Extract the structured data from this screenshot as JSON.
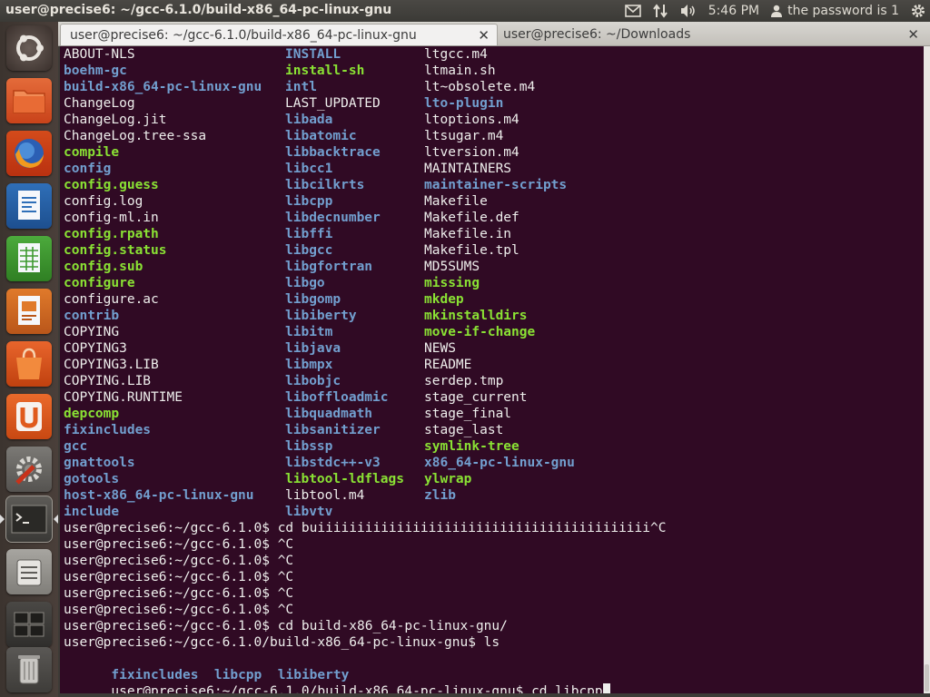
{
  "top_panel": {
    "window_title": "user@precise6: ~/gcc-6.1.0/build-x86_64-pc-linux-gnu",
    "clock": "5:46 PM",
    "user_label": "the password is 1"
  },
  "launcher": {
    "items": [
      "dash-home",
      "files",
      "firefox",
      "libreoffice-writer",
      "libreoffice-calc",
      "libreoffice-impress",
      "ubuntu-software-center",
      "ubuntu-one",
      "system-settings",
      "terminal",
      "backups",
      "workspace-switcher",
      "trash"
    ]
  },
  "tabs": [
    {
      "label": "user@precise6: ~/gcc-6.1.0/build-x86_64-pc-linux-gnu",
      "active": true
    },
    {
      "label": "user@precise6: ~/Downloads",
      "active": false
    }
  ],
  "colors": {
    "terminal_bg": "#300a24",
    "dir": "#729fcf",
    "exe": "#8ae234",
    "text": "#eeeeec"
  },
  "listing": [
    [
      [
        "ABOUT-NLS",
        "reg"
      ],
      [
        "INSTALL",
        "dir"
      ],
      [
        "ltgcc.m4",
        "reg"
      ]
    ],
    [
      [
        "boehm-gc",
        "dir"
      ],
      [
        "install-sh",
        "exe"
      ],
      [
        "ltmain.sh",
        "reg"
      ]
    ],
    [
      [
        "build-x86_64-pc-linux-gnu",
        "dir"
      ],
      [
        "intl",
        "dir"
      ],
      [
        "lt~obsolete.m4",
        "reg"
      ]
    ],
    [
      [
        "ChangeLog",
        "reg"
      ],
      [
        "LAST_UPDATED",
        "reg"
      ],
      [
        "lto-plugin",
        "dir"
      ]
    ],
    [
      [
        "ChangeLog.jit",
        "reg"
      ],
      [
        "libada",
        "dir"
      ],
      [
        "ltoptions.m4",
        "reg"
      ]
    ],
    [
      [
        "ChangeLog.tree-ssa",
        "reg"
      ],
      [
        "libatomic",
        "dir"
      ],
      [
        "ltsugar.m4",
        "reg"
      ]
    ],
    [
      [
        "compile",
        "exe"
      ],
      [
        "libbacktrace",
        "dir"
      ],
      [
        "ltversion.m4",
        "reg"
      ]
    ],
    [
      [
        "config",
        "dir"
      ],
      [
        "libcc1",
        "dir"
      ],
      [
        "MAINTAINERS",
        "reg"
      ]
    ],
    [
      [
        "config.guess",
        "exe"
      ],
      [
        "libcilkrts",
        "dir"
      ],
      [
        "maintainer-scripts",
        "dir"
      ]
    ],
    [
      [
        "config.log",
        "reg"
      ],
      [
        "libcpp",
        "dir"
      ],
      [
        "Makefile",
        "reg"
      ]
    ],
    [
      [
        "config-ml.in",
        "reg"
      ],
      [
        "libdecnumber",
        "dir"
      ],
      [
        "Makefile.def",
        "reg"
      ]
    ],
    [
      [
        "config.rpath",
        "exe"
      ],
      [
        "libffi",
        "dir"
      ],
      [
        "Makefile.in",
        "reg"
      ]
    ],
    [
      [
        "config.status",
        "exe"
      ],
      [
        "libgcc",
        "dir"
      ],
      [
        "Makefile.tpl",
        "reg"
      ]
    ],
    [
      [
        "config.sub",
        "exe"
      ],
      [
        "libgfortran",
        "dir"
      ],
      [
        "MD5SUMS",
        "reg"
      ]
    ],
    [
      [
        "configure",
        "exe"
      ],
      [
        "libgo",
        "dir"
      ],
      [
        "missing",
        "exe"
      ]
    ],
    [
      [
        "configure.ac",
        "reg"
      ],
      [
        "libgomp",
        "dir"
      ],
      [
        "mkdep",
        "exe"
      ]
    ],
    [
      [
        "contrib",
        "dir"
      ],
      [
        "libiberty",
        "dir"
      ],
      [
        "mkinstalldirs",
        "exe"
      ]
    ],
    [
      [
        "COPYING",
        "reg"
      ],
      [
        "libitm",
        "dir"
      ],
      [
        "move-if-change",
        "exe"
      ]
    ],
    [
      [
        "COPYING3",
        "reg"
      ],
      [
        "libjava",
        "dir"
      ],
      [
        "NEWS",
        "reg"
      ]
    ],
    [
      [
        "COPYING3.LIB",
        "reg"
      ],
      [
        "libmpx",
        "dir"
      ],
      [
        "README",
        "reg"
      ]
    ],
    [
      [
        "COPYING.LIB",
        "reg"
      ],
      [
        "libobjc",
        "dir"
      ],
      [
        "serdep.tmp",
        "reg"
      ]
    ],
    [
      [
        "COPYING.RUNTIME",
        "reg"
      ],
      [
        "liboffloadmic",
        "dir"
      ],
      [
        "stage_current",
        "reg"
      ]
    ],
    [
      [
        "depcomp",
        "exe"
      ],
      [
        "libquadmath",
        "dir"
      ],
      [
        "stage_final",
        "reg"
      ]
    ],
    [
      [
        "fixincludes",
        "dir"
      ],
      [
        "libsanitizer",
        "dir"
      ],
      [
        "stage_last",
        "reg"
      ]
    ],
    [
      [
        "gcc",
        "dir"
      ],
      [
        "libssp",
        "dir"
      ],
      [
        "symlink-tree",
        "exe"
      ]
    ],
    [
      [
        "gnattools",
        "dir"
      ],
      [
        "libstdc++-v3",
        "dir"
      ],
      [
        "x86_64-pc-linux-gnu",
        "dir"
      ]
    ],
    [
      [
        "gotools",
        "dir"
      ],
      [
        "libtool-ldflags",
        "exe"
      ],
      [
        "ylwrap",
        "exe"
      ]
    ],
    [
      [
        "host-x86_64-pc-linux-gnu",
        "dir"
      ],
      [
        "libtool.m4",
        "reg"
      ],
      [
        "zlib",
        "dir"
      ]
    ],
    [
      [
        "include",
        "dir"
      ],
      [
        "libvtv",
        "dir"
      ],
      [
        "",
        "reg"
      ]
    ]
  ],
  "history": [
    "user@precise6:~/gcc-6.1.0$ cd buiiiiiiiiiiiiiiiiiiiiiiiiiiiiiiiiiiiiiiiiii^C",
    "user@precise6:~/gcc-6.1.0$ ^C",
    "user@precise6:~/gcc-6.1.0$ ^C",
    "user@precise6:~/gcc-6.1.0$ ^C",
    "user@precise6:~/gcc-6.1.0$ ^C",
    "user@precise6:~/gcc-6.1.0$ ^C",
    "user@precise6:~/gcc-6.1.0$ cd build-x86_64-pc-linux-gnu/",
    "user@precise6:~/gcc-6.1.0/build-x86_64-pc-linux-gnu$ ls"
  ],
  "ls_output": [
    "fixincludes",
    "libcpp",
    "libiberty"
  ],
  "current_prompt": "user@precise6:~/gcc-6.1.0/build-x86_64-pc-linux-gnu$ ",
  "current_input": "cd libcpp"
}
